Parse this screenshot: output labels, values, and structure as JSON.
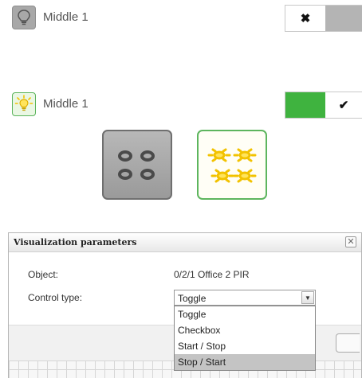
{
  "rows": [
    {
      "label": "Middle 1",
      "state": "off",
      "switch_glyph": "✖",
      "lamp_icon": "lightbulb-off-icon"
    },
    {
      "label": "Middle 1",
      "state": "on",
      "switch_glyph": "✔",
      "lamp_icon": "lightbulb-on-icon"
    }
  ],
  "tiles": [
    {
      "icon": "four-lights-off-icon",
      "state": "off"
    },
    {
      "icon": "four-lights-on-icon",
      "state": "on"
    }
  ],
  "colors": {
    "switch_on": "#3fb33f",
    "switch_off": "#b4b4b4",
    "lamp_on": "#f2c200",
    "tile_border_on": "#5db55e"
  },
  "dialog": {
    "title": "Visualization parameters",
    "close_glyph": "✕",
    "fields": {
      "object_label": "Object:",
      "object_value": "0/2/1 Office 2 PIR",
      "control_type_label": "Control type:",
      "control_type_value": "Toggle"
    },
    "dropdown_arrow": "▼",
    "options": [
      "Toggle",
      "Checkbox",
      "Start / Stop",
      "Stop / Start"
    ],
    "highlighted_option": "Stop / Start"
  }
}
